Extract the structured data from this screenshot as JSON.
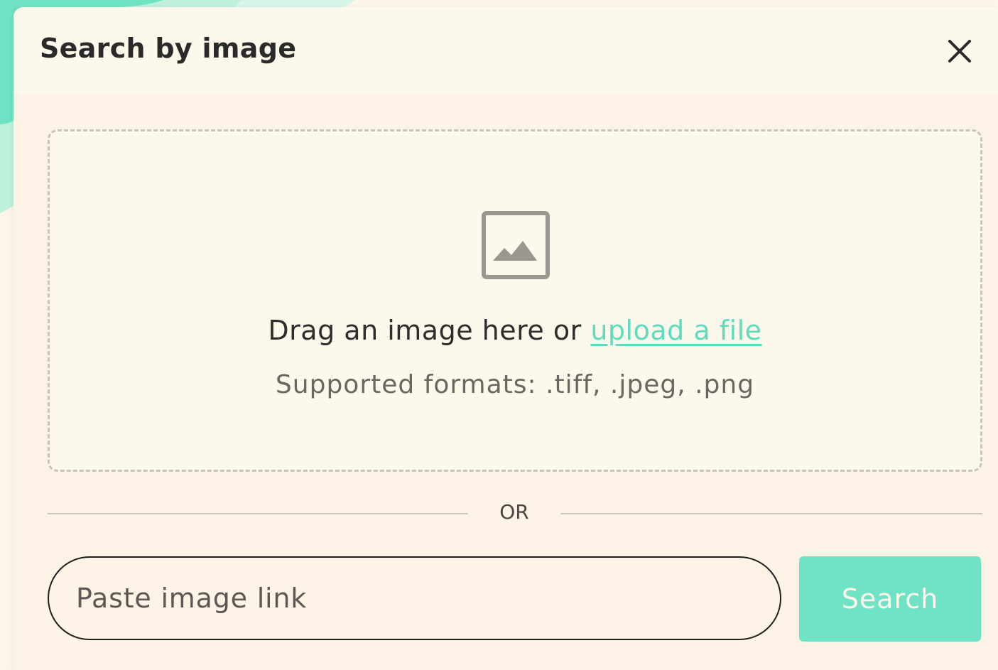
{
  "modal": {
    "title": "Search by image",
    "close_icon": "close-icon"
  },
  "dropzone": {
    "icon": "image-placeholder-icon",
    "drag_text": "Drag an image here or ",
    "upload_link": "upload a file",
    "formats": "Supported formats: .tiff, .jpeg, .png"
  },
  "divider": {
    "label": "OR"
  },
  "link_search": {
    "placeholder": "Paste image link",
    "value": "",
    "button_label": "Search"
  },
  "colors": {
    "accent": "#6fe3c3",
    "link": "#5fdcbe",
    "modal_background": "#fcf3e6",
    "header_background": "#fdf8ec"
  }
}
